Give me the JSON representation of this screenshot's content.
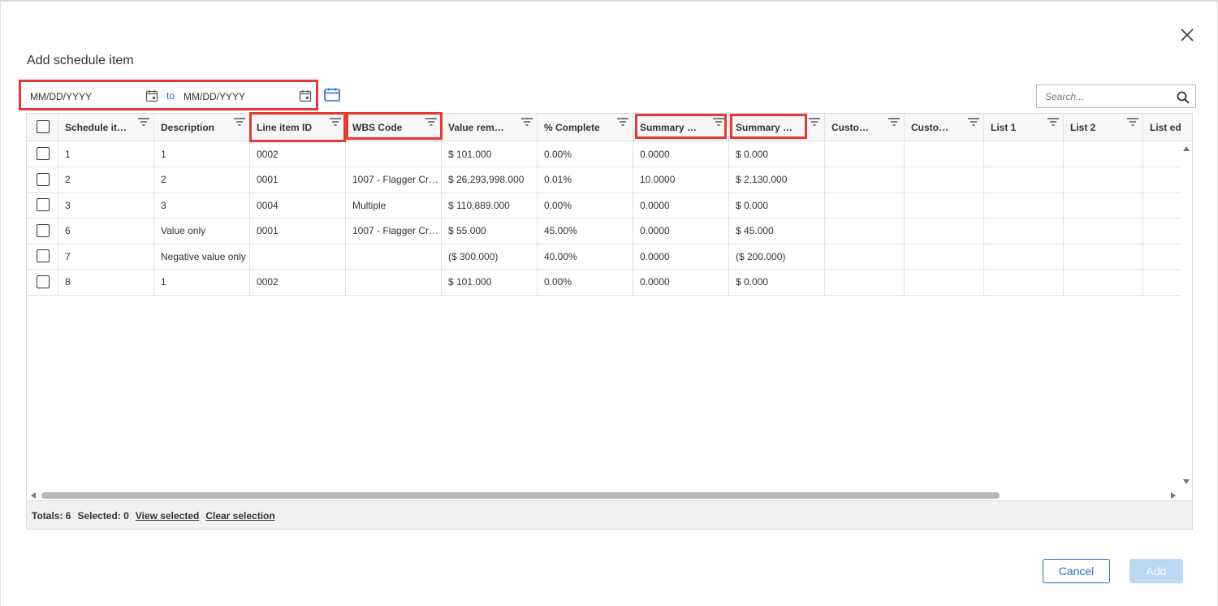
{
  "dialog": {
    "title": "Add schedule item"
  },
  "date_range": {
    "from_placeholder": "MM/DD/YYYY",
    "to_label": "to",
    "to_placeholder": "MM/DD/YYYY"
  },
  "search": {
    "placeholder": "Search..."
  },
  "columns": [
    "Schedule it…",
    "Description",
    "Line item ID",
    "WBS Code",
    "Value rem…",
    "% Complete",
    "Summary …",
    "Summary …",
    "Custo…",
    "Custo…",
    "List 1",
    "List 2",
    "List ed"
  ],
  "rows": [
    [
      "1",
      "1",
      "0002",
      "",
      "$ 101.000",
      "0.00%",
      "0.0000",
      "$ 0.000",
      "",
      "",
      "",
      "",
      ""
    ],
    [
      "2",
      "2",
      "0001",
      "1007 - Flagger Cr…",
      "$ 26,293,998.000",
      "0.01%",
      "10.0000",
      "$ 2,130.000",
      "",
      "",
      "",
      "",
      ""
    ],
    [
      "3",
      "3",
      "0004",
      "Multiple",
      "$ 110,889.000",
      "0.00%",
      "0.0000",
      "$ 0.000",
      "",
      "",
      "",
      "",
      ""
    ],
    [
      "6",
      "Value only",
      "0001",
      "1007 - Flagger Cr…",
      "$ 55.000",
      "45.00%",
      "0.0000",
      "$ 45.000",
      "",
      "",
      "",
      "",
      ""
    ],
    [
      "7",
      "Negative value only",
      "",
      "",
      "($ 300.000)",
      "40.00%",
      "0.0000",
      "($ 200.000)",
      "",
      "",
      "",
      "",
      ""
    ],
    [
      "8",
      "1",
      "0002",
      "",
      "$ 101.000",
      "0.00%",
      "0.0000",
      "$ 0.000",
      "",
      "",
      "",
      "",
      ""
    ]
  ],
  "footer": {
    "totals": "Totals: 6",
    "selected": "Selected: 0",
    "view_selected": "View selected",
    "clear_selection": "Clear selection"
  },
  "buttons": {
    "cancel": "Cancel",
    "add": "Add"
  },
  "colors": {
    "highlight": "#e53935",
    "accent": "#1e6fc6",
    "add_disabled": "#bcd8f3"
  },
  "icons": {
    "close": "close-icon",
    "calendar": "calendar-icon",
    "search": "search-icon",
    "filter": "filter-icon"
  }
}
